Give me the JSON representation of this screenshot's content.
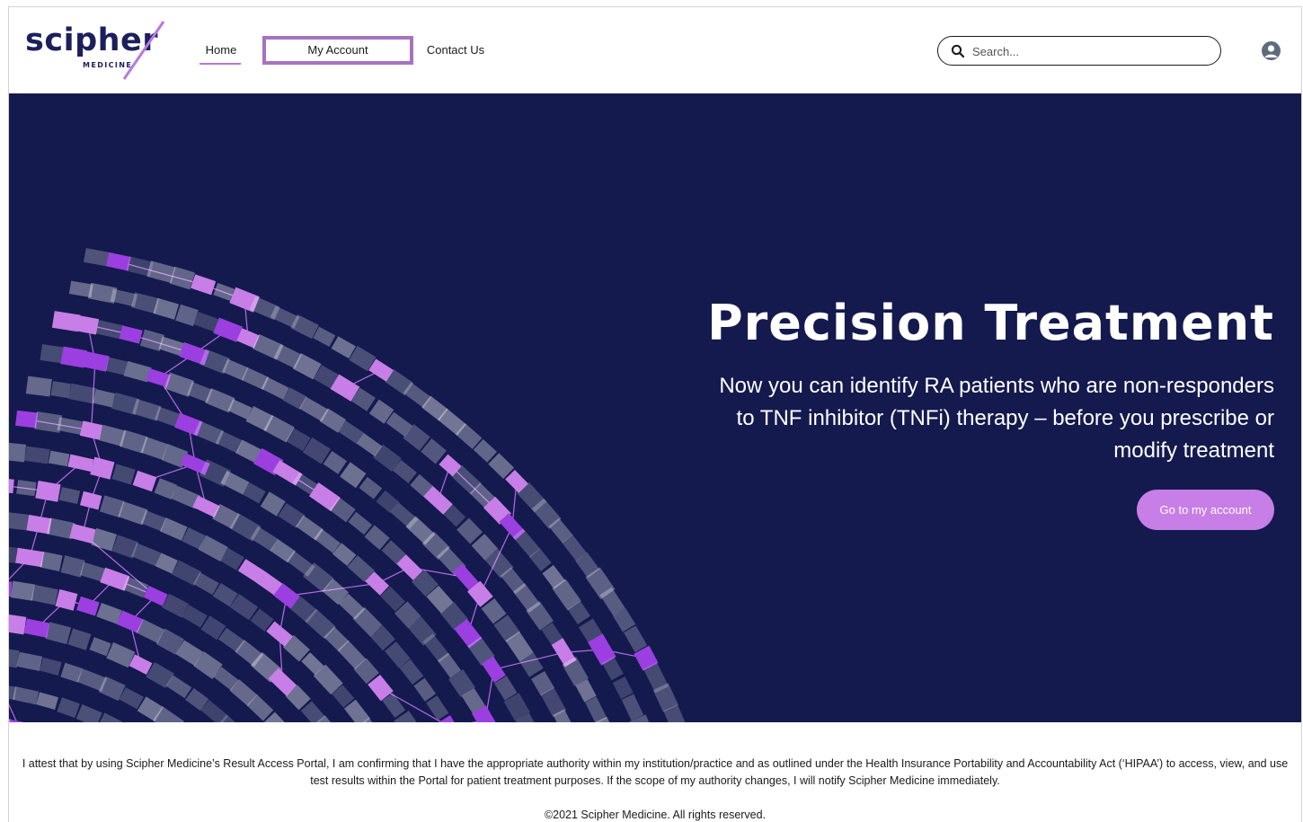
{
  "brand": {
    "name": "scipher",
    "tagline": "MEDICINE",
    "colors": {
      "navy": "#1c1f5b",
      "accent": "#c77ee6",
      "hero_bg": "#141a4e",
      "highlight_border": "#a872c2"
    }
  },
  "nav": {
    "items": [
      {
        "label": "Home",
        "active": true
      },
      {
        "label": "My Account",
        "highlighted": true
      },
      {
        "label": "Contact Us"
      }
    ]
  },
  "search": {
    "placeholder": "Search...",
    "icon": "search-icon"
  },
  "user": {
    "icon": "user-avatar-icon"
  },
  "hero": {
    "title": "Precision Treatment",
    "subtitle": "Now you can identify RA patients who are non-responders to TNF inhibitor (TNFi) therapy – before you prescribe or modify treatment",
    "cta_label": "Go to my account"
  },
  "footer": {
    "attestation": "I attest that by using Scipher Medicine’s Result Access Portal, I am confirming that I have the appropriate authority within my institution/practice and as outlined under the Health Insurance Portability and Accountability Act (‘HIPAA’) to access, view, and use test results within the Portal for patient treatment purposes. If the scope of my authority changes, I will notify Scipher Medicine immediately.",
    "copyright": "©2021 Scipher Medicine. All rights reserved."
  }
}
